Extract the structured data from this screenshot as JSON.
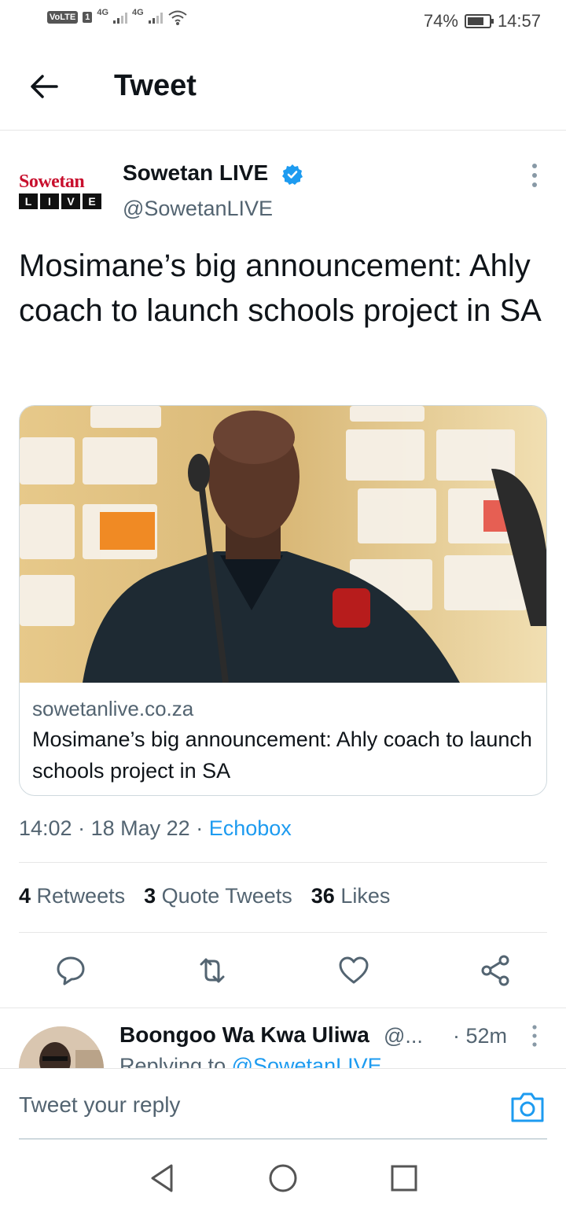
{
  "status_bar": {
    "volte": "VoLTE",
    "sim": "1",
    "net1": "4G",
    "net2": "4G",
    "battery_percent": "74%",
    "time": "14:57"
  },
  "header": {
    "title": "Tweet",
    "back_icon": "arrow-left-icon"
  },
  "tweet": {
    "logo_top": "Sowetan",
    "logo_letters": [
      "L",
      "I",
      "V",
      "E"
    ],
    "author_name": "Sowetan LIVE",
    "handle": "@SowetanLIVE",
    "text": "Mosimane’s big announcement: Ahly coach to launch schools project in SA",
    "card": {
      "domain": "sowetanlive.co.za",
      "title": "Mosimane’s big announcement: Ahly coach to launch schools project in SA"
    },
    "meta": {
      "time": "14:02",
      "date": "18 May 22",
      "source": "Echobox"
    },
    "stats": {
      "retweets_count": "4",
      "retweets_label": "Retweets",
      "quotes_count": "3",
      "quotes_label": "Quote Tweets",
      "likes_count": "36",
      "likes_label": "Likes"
    }
  },
  "reply_preview": {
    "name": "Boongoo Wa Kwa Uliwa",
    "handle": "@...",
    "time": "· 52m",
    "replying_prefix": "Replying to",
    "replying_handle": "@SowetanLIVE"
  },
  "compose": {
    "placeholder": "Tweet your reply"
  },
  "colors": {
    "accent": "#1d9bf0",
    "text": "#0f1419",
    "muted": "#536471",
    "brand_red": "#c8102e"
  }
}
